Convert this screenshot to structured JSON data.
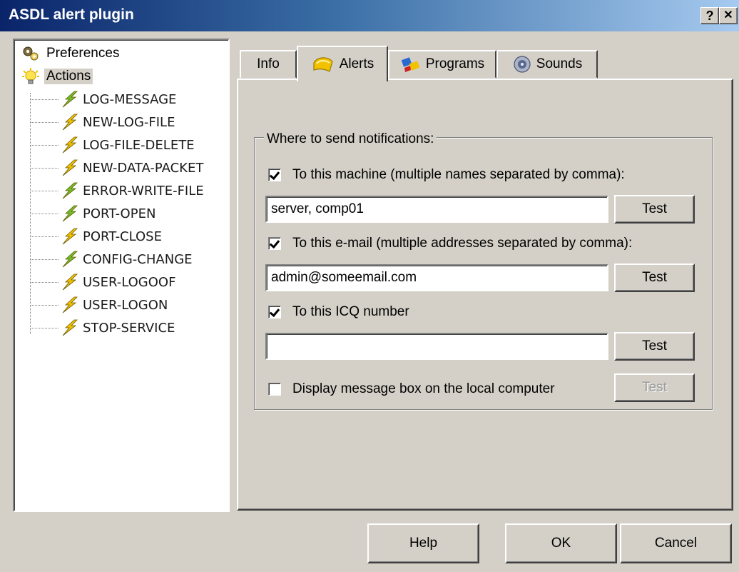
{
  "window": {
    "title": "ASDL alert plugin",
    "help_glyph": "?",
    "close_glyph": "✕"
  },
  "tree": {
    "roots": [
      {
        "label": "Preferences",
        "icon": "preferences-icon"
      },
      {
        "label": "Actions",
        "icon": "lightbulb-icon",
        "selected": true
      }
    ],
    "actions": [
      {
        "label": "LOG-MESSAGE",
        "icon_color": "green"
      },
      {
        "label": "NEW-LOG-FILE",
        "icon_color": "yellow"
      },
      {
        "label": "LOG-FILE-DELETE",
        "icon_color": "yellow"
      },
      {
        "label": "NEW-DATA-PACKET",
        "icon_color": "yellow"
      },
      {
        "label": "ERROR-WRITE-FILE",
        "icon_color": "green"
      },
      {
        "label": "PORT-OPEN",
        "icon_color": "green"
      },
      {
        "label": "PORT-CLOSE",
        "icon_color": "yellow"
      },
      {
        "label": "CONFIG-CHANGE",
        "icon_color": "green"
      },
      {
        "label": "USER-LOGOOF",
        "icon_color": "yellow"
      },
      {
        "label": "USER-LOGON",
        "icon_color": "yellow"
      },
      {
        "label": "STOP-SERVICE",
        "icon_color": "yellow"
      }
    ]
  },
  "tabs": [
    {
      "label": "Info",
      "icon": null
    },
    {
      "label": "Alerts",
      "icon": "bell-icon",
      "active": true
    },
    {
      "label": "Programs",
      "icon": "programs-icon"
    },
    {
      "label": "Sounds",
      "icon": "speaker-icon"
    }
  ],
  "alerts": {
    "group_title": "Where to send notifications:",
    "machine": {
      "label": "To this machine (multiple names separated by comma):",
      "checked": true,
      "value": "server, comp01",
      "test_label": "Test"
    },
    "email": {
      "label": "To this e-mail (multiple addresses separated by comma):",
      "checked": true,
      "value": "admin@someemail.com",
      "test_label": "Test"
    },
    "icq": {
      "label": "To this ICQ number",
      "checked": true,
      "value": "",
      "test_label": "Test"
    },
    "msgbox": {
      "label": "Display message box on the local computer",
      "checked": false,
      "test_label": "Test",
      "test_disabled": true
    }
  },
  "buttons": {
    "help": "Help",
    "ok": "OK",
    "cancel": "Cancel"
  },
  "colors": {
    "titlebar_start": "#0a246a",
    "titlebar_end": "#a6caf0",
    "face": "#d4d0c8",
    "bolt_green": "#6fbf2a",
    "bolt_yellow": "#f2c200"
  }
}
